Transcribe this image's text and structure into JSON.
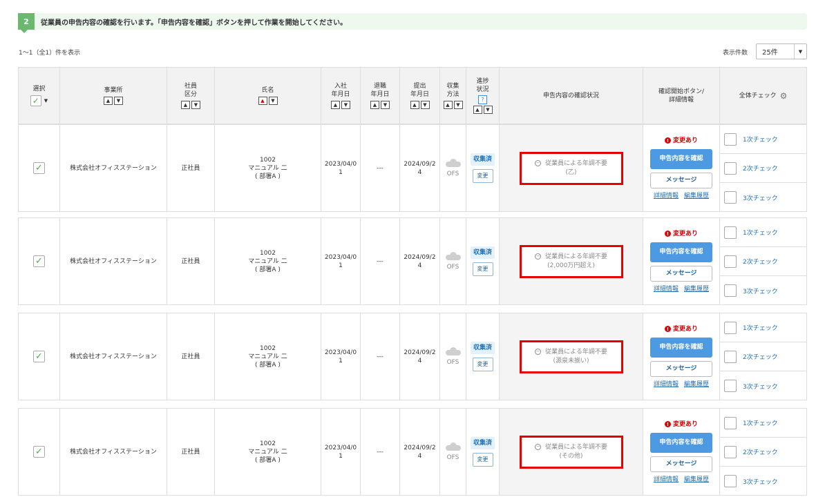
{
  "step": {
    "number": "2",
    "text": "従業員の申告内容の確認を行います。「申告内容を確認」ボタンを押して作業を開始してください。"
  },
  "count_text": "1～1（全1）件を表示",
  "per_page": {
    "label": "表示件数",
    "value": "25件"
  },
  "headers": {
    "select": "選択",
    "office": "事業所",
    "emp_type": [
      "社員",
      "区分"
    ],
    "name": "氏名",
    "hire_date": [
      "入社",
      "年月日"
    ],
    "leave_date": [
      "退職",
      "年月日"
    ],
    "submit_date": [
      "提出",
      "年月日"
    ],
    "collect_method": [
      "収集",
      "方法"
    ],
    "progress": [
      "進捗",
      "状況"
    ],
    "confirm_status": "申告内容の確認状況",
    "action": [
      "確認開始ボタン/",
      "詳細情報"
    ],
    "all_check": "全体チェック"
  },
  "rows": [
    {
      "office": "株式会社オフィスステーション",
      "emp_type": "正社員",
      "emp_no": "1002",
      "name": "マニュアル 二",
      "dept": "( 部署A )",
      "hire": [
        "2023/04/0",
        "1"
      ],
      "leave": "---",
      "submit": [
        "2024/09/2",
        "4"
      ],
      "method": "OFS",
      "progress": "収集済",
      "change": "変更",
      "status_main": "従業員による年調不要",
      "status_sub": "(乙)",
      "changed": "変更あり",
      "confirm": "申告内容を確認",
      "message": "メッセージ",
      "detail": "詳細情報",
      "history": "編集履歴",
      "checks": [
        "1次チェック",
        "2次チェック",
        "3次チェック"
      ]
    },
    {
      "office": "株式会社オフィスステーション",
      "emp_type": "正社員",
      "emp_no": "1002",
      "name": "マニュアル 二",
      "dept": "( 部署A )",
      "hire": [
        "2023/04/0",
        "1"
      ],
      "leave": "---",
      "submit": [
        "2024/09/2",
        "4"
      ],
      "method": "OFS",
      "progress": "収集済",
      "change": "変更",
      "status_main": "従業員による年調不要",
      "status_sub": "(2,000万円超え)",
      "changed": "変更あり",
      "confirm": "申告内容を確認",
      "message": "メッセージ",
      "detail": "詳細情報",
      "history": "編集履歴",
      "checks": [
        "1次チェック",
        "2次チェック",
        "3次チェック"
      ]
    },
    {
      "office": "株式会社オフィスステーション",
      "emp_type": "正社員",
      "emp_no": "1002",
      "name": "マニュアル 二",
      "dept": "( 部署A )",
      "hire": [
        "2023/04/0",
        "1"
      ],
      "leave": "---",
      "submit": [
        "2024/09/2",
        "4"
      ],
      "method": "OFS",
      "progress": "収集済",
      "change": "変更",
      "status_main": "従業員による年調不要",
      "status_sub": "(源泉未揃い)",
      "changed": "変更あり",
      "confirm": "申告内容を確認",
      "message": "メッセージ",
      "detail": "詳細情報",
      "history": "編集履歴",
      "checks": [
        "1次チェック",
        "2次チェック",
        "3次チェック"
      ]
    },
    {
      "office": "株式会社オフィスステーション",
      "emp_type": "正社員",
      "emp_no": "1002",
      "name": "マニュアル 二",
      "dept": "( 部署A )",
      "hire": [
        "2023/04/0",
        "1"
      ],
      "leave": "---",
      "submit": [
        "2024/09/2",
        "4"
      ],
      "method": "OFS",
      "progress": "収集済",
      "change": "変更",
      "status_main": "従業員による年調不要",
      "status_sub": "(その他)",
      "changed": "変更あり",
      "confirm": "申告内容を確認",
      "message": "メッセージ",
      "detail": "詳細情報",
      "history": "編集履歴",
      "checks": [
        "1次チェック",
        "2次チェック",
        "3次チェック"
      ]
    }
  ]
}
